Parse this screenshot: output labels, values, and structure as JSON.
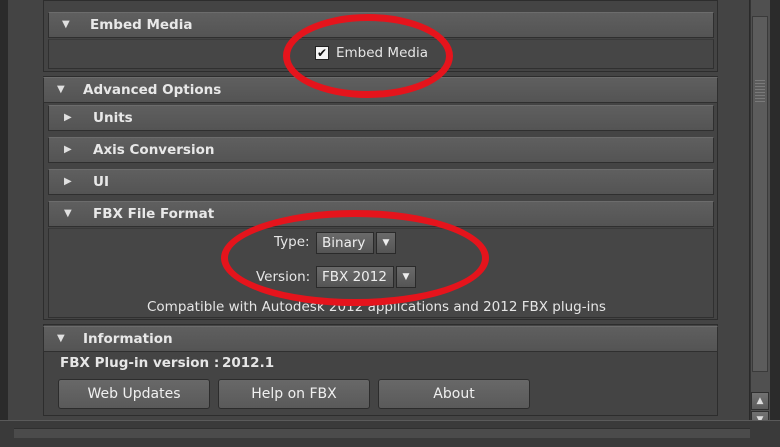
{
  "embed_media": {
    "header": "Embed Media",
    "checkbox_checked": true,
    "checkbox_label": "Embed Media"
  },
  "advanced": {
    "header": "Advanced Options",
    "subsections": [
      {
        "label": "Units",
        "expanded": false
      },
      {
        "label": "Axis Conversion",
        "expanded": false
      },
      {
        "label": "UI",
        "expanded": false
      },
      {
        "label": "FBX File Format",
        "expanded": true
      }
    ],
    "fbx_format": {
      "type_label": "Type:",
      "type_value": "Binary",
      "version_label": "Version:",
      "version_value": "FBX 2012",
      "compat_text": "Compatible with Autodesk 2012 applications and 2012 FBX plug-ins"
    }
  },
  "information": {
    "header": "Information",
    "plugin_version_label": "FBX Plug-in version :",
    "plugin_version_value": "2012.1",
    "buttons": [
      "Web Updates",
      "Help on FBX",
      "About"
    ]
  },
  "icons": {
    "expanded": "▼",
    "collapsed": "▶",
    "check": "✔",
    "combo_arrow": "▼",
    "scroll_up": "▲",
    "scroll_down": "▼"
  },
  "colors": {
    "annotation": "#e5141c",
    "panel": "#444444",
    "header": "#5a5a5a"
  }
}
